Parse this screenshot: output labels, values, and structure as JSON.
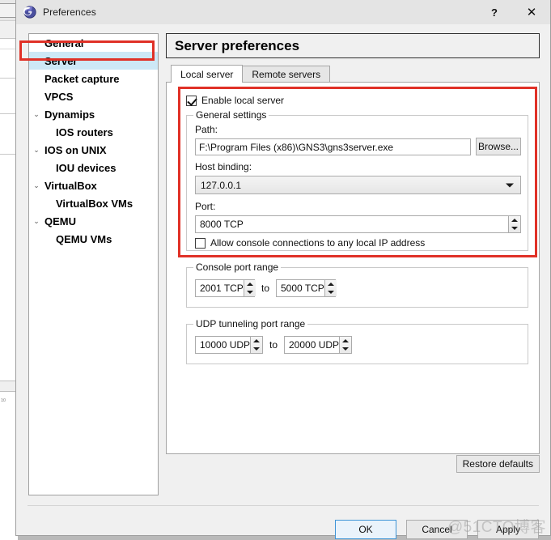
{
  "window": {
    "title": "Preferences",
    "icon": "gns3-logo-icon",
    "help_label": "?",
    "close_label": "✕"
  },
  "sidebar": {
    "items": [
      {
        "label": "General",
        "level": 0,
        "expandable": false,
        "selected": false
      },
      {
        "label": "Server",
        "level": 0,
        "expandable": false,
        "selected": true
      },
      {
        "label": "Packet capture",
        "level": 0,
        "expandable": false,
        "selected": false
      },
      {
        "label": "VPCS",
        "level": 0,
        "expandable": false,
        "selected": false
      },
      {
        "label": "Dynamips",
        "level": 0,
        "expandable": true,
        "selected": false
      },
      {
        "label": "IOS routers",
        "level": 1,
        "expandable": false,
        "selected": false
      },
      {
        "label": "IOS on UNIX",
        "level": 0,
        "expandable": true,
        "selected": false
      },
      {
        "label": "IOU devices",
        "level": 1,
        "expandable": false,
        "selected": false
      },
      {
        "label": "VirtualBox",
        "level": 0,
        "expandable": true,
        "selected": false
      },
      {
        "label": "VirtualBox VMs",
        "level": 1,
        "expandable": false,
        "selected": false
      },
      {
        "label": "QEMU",
        "level": 0,
        "expandable": true,
        "selected": false
      },
      {
        "label": "QEMU VMs",
        "level": 1,
        "expandable": false,
        "selected": false
      }
    ],
    "chevron_glyph": "⌄"
  },
  "main": {
    "page_title": "Server preferences",
    "tabs": [
      {
        "label": "Local server",
        "active": true
      },
      {
        "label": "Remote servers",
        "active": false
      }
    ],
    "enable_local_server": {
      "label": "Enable local server",
      "checked": true
    },
    "general_settings": {
      "title": "General settings",
      "path_label": "Path:",
      "path_value": "F:\\Program Files (x86)\\GNS3\\gns3server.exe",
      "browse_label": "Browse...",
      "host_binding_label": "Host binding:",
      "host_binding_value": "127.0.0.1",
      "port_label": "Port:",
      "port_value": "8000 TCP",
      "allow_console_label": "Allow console connections to any local IP address",
      "allow_console_checked": false
    },
    "console_port_range": {
      "title": "Console port range",
      "from_value": "2001 TCP",
      "to_label": "to",
      "to_value": "5000 TCP"
    },
    "udp_tunneling_port_range": {
      "title": "UDP tunneling port range",
      "from_value": "10000 UDP",
      "to_label": "to",
      "to_value": "20000 UDP"
    },
    "restore_defaults_label": "Restore defaults"
  },
  "footer": {
    "ok_label": "OK",
    "cancel_label": "Cancel",
    "apply_label": "Apply"
  },
  "watermark": {
    "text": "@51CTO博客"
  },
  "colors": {
    "annotation_red": "#e03127",
    "selection_blue": "#cde8f6",
    "dialog_bg": "#f0f0f0",
    "default_button_border": "#3e94d6"
  }
}
